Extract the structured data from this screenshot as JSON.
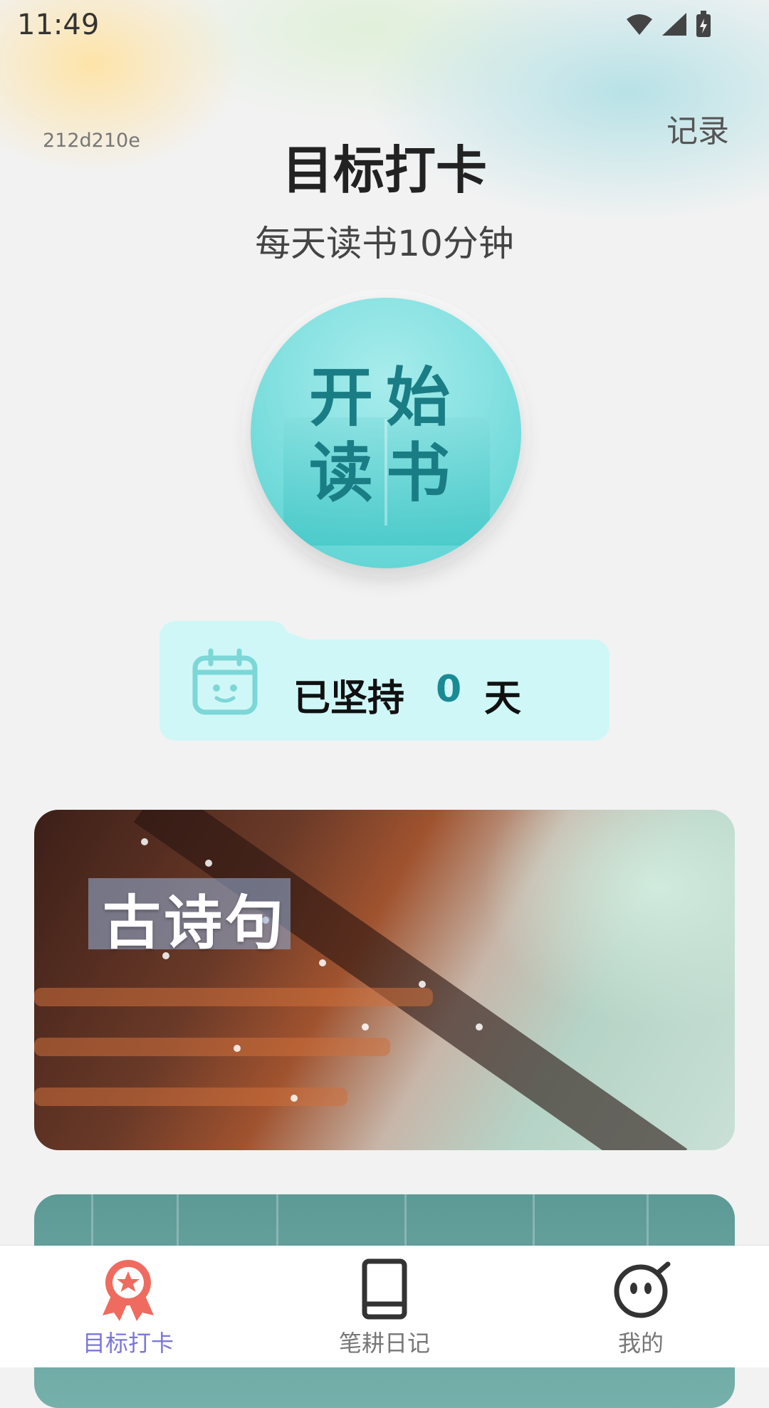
{
  "status_bar": {
    "time": "11:49",
    "icons": [
      "wifi-icon",
      "signal-icon",
      "battery-charging-icon"
    ]
  },
  "header": {
    "record_label": "记录",
    "version_id": "212d210e",
    "title": "目标打卡",
    "subtitle": "每天读书10分钟"
  },
  "start_button": {
    "line1": "开始",
    "line2": "读书",
    "icon": "open-book-icon",
    "color": "#5fd3d3"
  },
  "streak": {
    "prefix": "已坚持",
    "count": "0",
    "unit": "天",
    "icon": "calendar-smile-icon",
    "count_color": "#1a8a94"
  },
  "cards": [
    {
      "title": "古诗句"
    },
    {
      "title": ""
    }
  ],
  "tab_bar": {
    "active_color": "#7a78d6",
    "active_icon_color": "#ef6b5f",
    "items": [
      {
        "label": "目标打卡",
        "icon": "award-ribbon-icon",
        "active": true
      },
      {
        "label": "笔耕日记",
        "icon": "book-icon",
        "active": false
      },
      {
        "label": "我的",
        "icon": "smiley-face-icon",
        "active": false
      }
    ]
  }
}
